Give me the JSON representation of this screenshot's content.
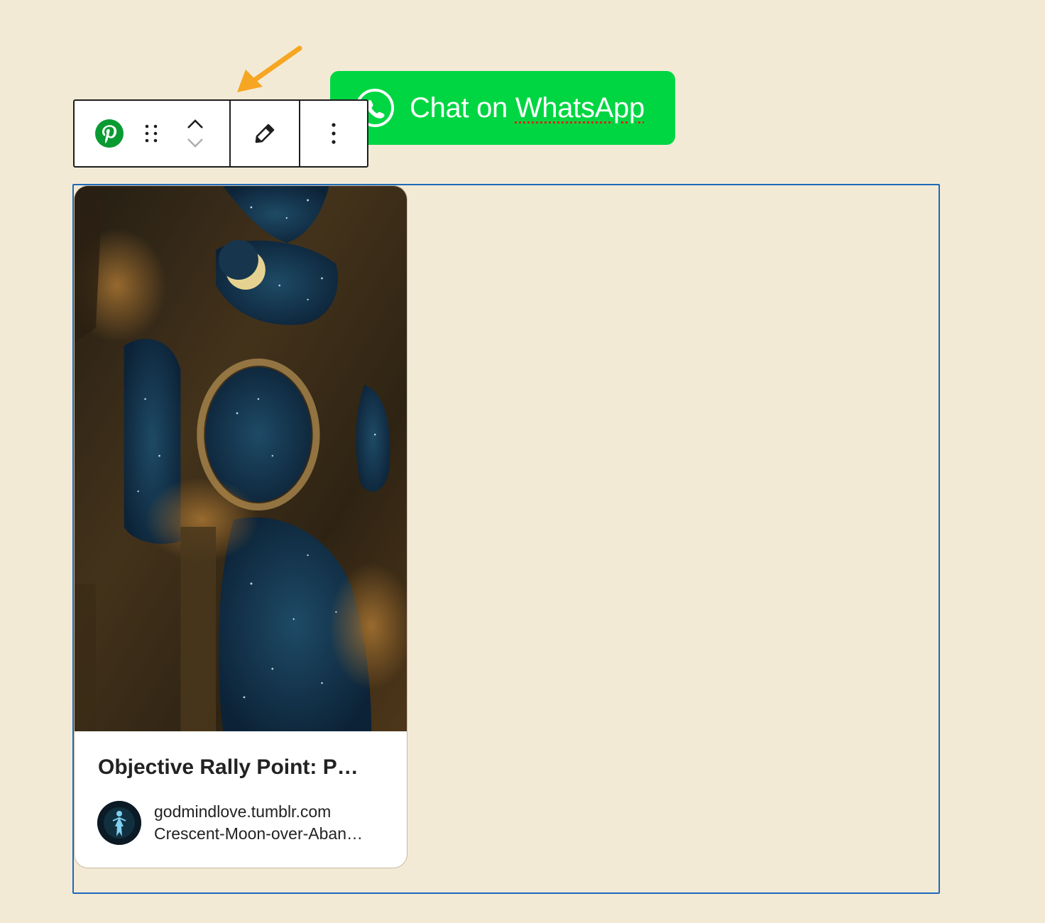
{
  "colors": {
    "page_background": "#f3ead6",
    "whatsapp_green": "#00d642",
    "pinterest_green": "#0a9a32",
    "selection_blue": "#1d69b8",
    "annotation_arrow": "#f6a623",
    "spellcheck_underline": "#d9241c"
  },
  "whatsapp_button": {
    "label_prefix": "Chat on ",
    "label_word": "WhatsApp",
    "icon": "whatsapp-icon"
  },
  "toolbar": {
    "block_icon": "pinterest-icon",
    "drag_icon": "drag-handle-icon",
    "move_up_icon": "chevron-up-icon",
    "move_down_icon": "chevron-down-icon",
    "edit_icon": "pencil-icon",
    "more_icon": "more-vertical-icon"
  },
  "pin_card": {
    "title": "Objective Rally Point: P…",
    "source_domain": "godmindlove.tumblr.com",
    "source_path": "Crescent-Moon-over-Aban…"
  }
}
